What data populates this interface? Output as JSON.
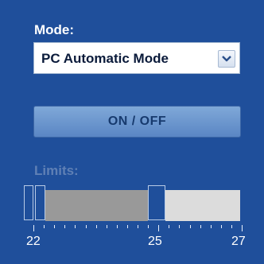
{
  "mode": {
    "label": "Mode:",
    "selected": "PC Automatic Mode"
  },
  "power": {
    "label": "ON / OFF"
  },
  "limits": {
    "label": "Limits:",
    "scale": [
      "22",
      "25",
      "27"
    ],
    "min": 22,
    "max": 27,
    "low_value": 22,
    "high_value": 25
  },
  "colors": {
    "background": "#1f4f9b",
    "button": "#6f98cf",
    "track_dark": "#999999",
    "track_light": "#dcdcdc"
  },
  "icons": {
    "dropdown": "chevron-down-icon"
  }
}
